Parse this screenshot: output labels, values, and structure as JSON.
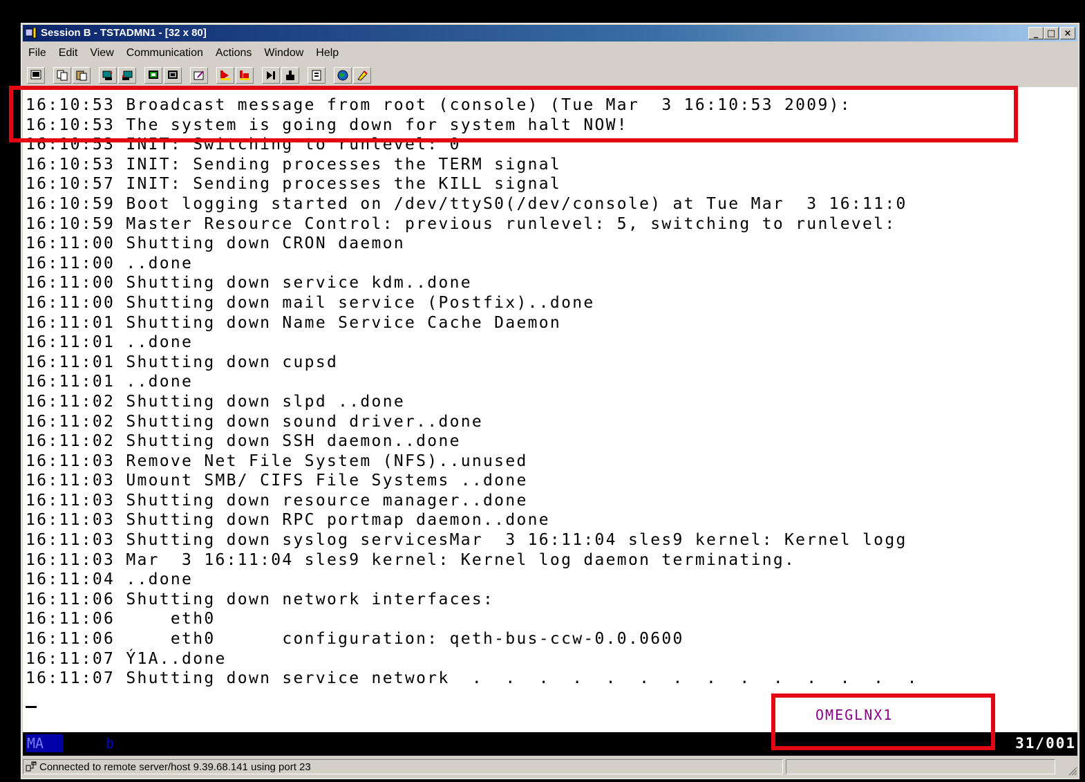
{
  "window": {
    "title": "Session B - TSTADMN1 - [32 x 80]",
    "controls": [
      "_",
      "□",
      "×"
    ]
  },
  "menu": [
    "File",
    "Edit",
    "View",
    "Communication",
    "Actions",
    "Window",
    "Help"
  ],
  "toolbar": {
    "icons": [
      "print-screen-icon",
      "copy-icon",
      "paste-icon",
      "send-file-icon",
      "receive-file-icon",
      "display-setup-icon",
      "keyboard-setup-icon",
      "macro-icon",
      "record-macro-icon",
      "stop-macro-icon",
      "play-macro-icon",
      "keyboard-map-icon",
      "clipboard-icon",
      "color-map-icon",
      "help-icon"
    ]
  },
  "terminal": {
    "lines": [
      "16:10:53 Broadcast message from root (console) (Tue Mar  3 16:10:53 2009):",
      "16:10:53 The system is going down for system halt NOW!",
      "16:10:53 INIT: Switching to runlevel: 0",
      "16:10:53 INIT: Sending processes the TERM signal",
      "16:10:57 INIT: Sending processes the KILL signal",
      "16:10:59 Boot logging started on /dev/ttyS0(/dev/console) at Tue Mar  3 16:11:0",
      "16:10:59 Master Resource Control: previous runlevel: 5, switching to runlevel:",
      "16:11:00 Shutting down CRON daemon",
      "16:11:00 ..done",
      "16:11:00 Shutting down service kdm..done",
      "16:11:00 Shutting down mail service (Postfix)..done",
      "16:11:01 Shutting down Name Service Cache Daemon",
      "16:11:01 ..done",
      "16:11:01 Shutting down cupsd",
      "16:11:01 ..done",
      "16:11:02 Shutting down slpd ..done",
      "16:11:02 Shutting down sound driver..done",
      "16:11:02 Shutting down SSH daemon..done",
      "16:11:03 Remove Net File System (NFS)..unused",
      "16:11:03 Umount SMB/ CIFS File Systems ..done",
      "16:11:03 Shutting down resource manager..done",
      "16:11:03 Shutting down RPC portmap daemon..done",
      "16:11:03 Shutting down syslog servicesMar  3 16:11:04 sles9 kernel: Kernel logg",
      "16:11:03 Mar  3 16:11:04 sles9 kernel: Kernel log daemon terminating.",
      "16:11:04 ..done",
      "16:11:06 Shutting down network interfaces:",
      "16:11:06     eth0",
      "16:11:06     eth0      configuration: qeth-bus-ccw-0.0.0600",
      "16:11:07 Ý1A..done",
      "16:11:07 Shutting down service network  .  .  .  .  .  .  .  .  .  .  .  .  .  ."
    ],
    "system_name": "OMEGLNX1"
  },
  "oia": {
    "ma": "MA",
    "b": "b",
    "cursor_position": "31/001"
  },
  "status": {
    "text": "Connected to remote server/host 9.39.68.141 using port 23"
  },
  "colors": {
    "highlight": "#e30613",
    "system_name": "#8b008b"
  }
}
